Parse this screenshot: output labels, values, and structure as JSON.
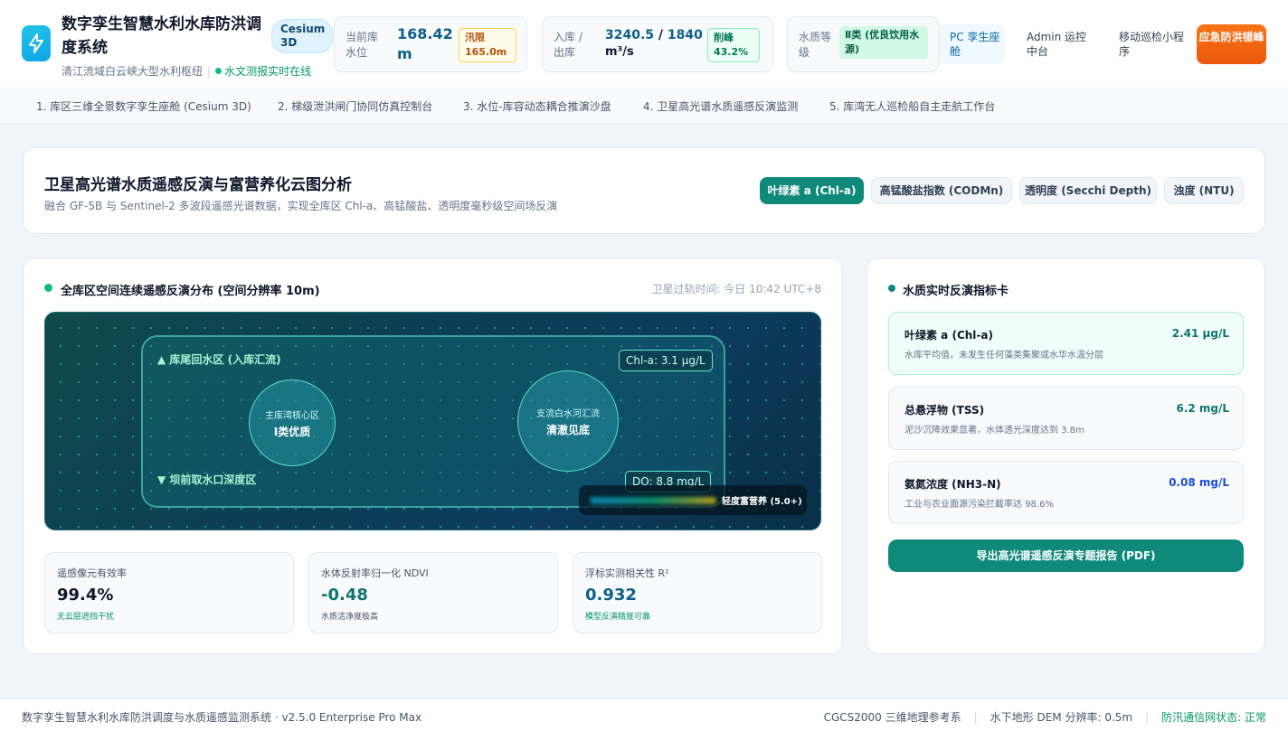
{
  "header": {
    "title": "数字孪生智慧水利水库防洪调度系统",
    "cesium_tag": "Cesium 3D",
    "subtitle": "清江流域白云峡大型水利枢纽",
    "live_status": "水文测报实时在线",
    "water_level": {
      "label": "当前库水位",
      "value": "168.42 m",
      "badge": "汛限 165.0m"
    },
    "flow": {
      "label": "入库 / 出库",
      "inflow": "3240.5",
      "slash": "/",
      "outflow": "1840",
      "unit": "m³/s",
      "badge": "削峰 43.2%"
    },
    "quality": {
      "label": "水质等级",
      "badge": "Ⅱ类 (优良饮用水源)"
    },
    "nav": {
      "pc": "PC 孪生座舱",
      "admin": "Admin 运控中台",
      "mobile": "移动巡检小程序",
      "emergency": "应急防洪错峰"
    }
  },
  "tabs": [
    "1. 库区三维全景数字孪生座舱 (Cesium 3D)",
    "2. 梯级泄洪闸门协同仿真控制台",
    "3. 水位-库容动态耦合推演沙盘",
    "4. 卫星高光谱水质遥感反演监测",
    "5. 库湾无人巡检船自主走航工作台"
  ],
  "analysis": {
    "title": "卫星高光谱水质遥感反演与富营养化云图分析",
    "subtitle": "融合 GF-5B 与 Sentinel-2 多波段遥感光谱数据，实现全库区 Chl-a、高锰酸盐、透明度毫秒级空间场反演",
    "chips": [
      "叶绿素 a (Chl-a)",
      "高锰酸盐指数 (CODMn)",
      "透明度 (Secchi Depth)",
      "浊度 (NTU)"
    ],
    "active_chip": 0
  },
  "map_section": {
    "title": "全库区空间连续遥感反演分布 (空间分辨率 10m)",
    "sat_time": "卫星过轨时间: 今日 10:42 UTC+8",
    "zone_top": "▲ 库尾回水区 (入库汇流)",
    "zone_bottom": "▼ 坝前取水口深度区",
    "tag_chl": "Chl-a: 3.1 μg/L",
    "tag_do": "DO: 8.8 mg/L",
    "circle_left": {
      "line1": "主库湾核心区",
      "line2": "Ⅰ类优质"
    },
    "circle_right": {
      "line1": "支流白水河汇流",
      "line2": "清澈见底"
    },
    "legend_label": "轻度富营养 (5.0+)"
  },
  "metrics": [
    {
      "label": "遥感像元有效率",
      "value": "99.4%",
      "note": "无云层遮挡干扰",
      "color": "#0f172a",
      "note_color": "#059669"
    },
    {
      "label": "水体反射率归一化 NDVI",
      "value": "-0.48",
      "note": "水质洁净度极高",
      "color": "#0f766e",
      "note_color": "#475569"
    },
    {
      "label": "浮标实测相关性 R²",
      "value": "0.932",
      "note": "模型反演精度可靠",
      "color": "#0e5f8a",
      "note_color": "#059669"
    }
  ],
  "indicators": {
    "title": "水质实时反演指标卡",
    "items": [
      {
        "name": "叶绿素 a (Chl-a)",
        "value": "2.41 μg/L",
        "desc": "水库平均值，未发生任何藻类集聚或水华水温分层",
        "color": "#0f766e"
      },
      {
        "name": "总悬浮物 (TSS)",
        "value": "6.2 mg/L",
        "desc": "泥沙沉降效果显著，水体透光深度达到 3.8m",
        "color": "#0f766e"
      },
      {
        "name": "氨氮浓度 (NH3-N)",
        "value": "0.08 mg/L",
        "desc": "工业与农业面源污染拦截率达 98.6%",
        "color": "#1d4ed8"
      }
    ],
    "export_label": "导出高光谱遥感反演专题报告 (PDF)"
  },
  "footer": {
    "left": "数字孪生智慧水利水库防洪调度与水质遥感监测系统 · v2.5.0 Enterprise Pro Max",
    "crs": "CGCS2000 三维地理参考系",
    "dem": "水下地形 DEM 分辨率: 0.5m",
    "comm": "防汛通信网状态: 正常"
  }
}
